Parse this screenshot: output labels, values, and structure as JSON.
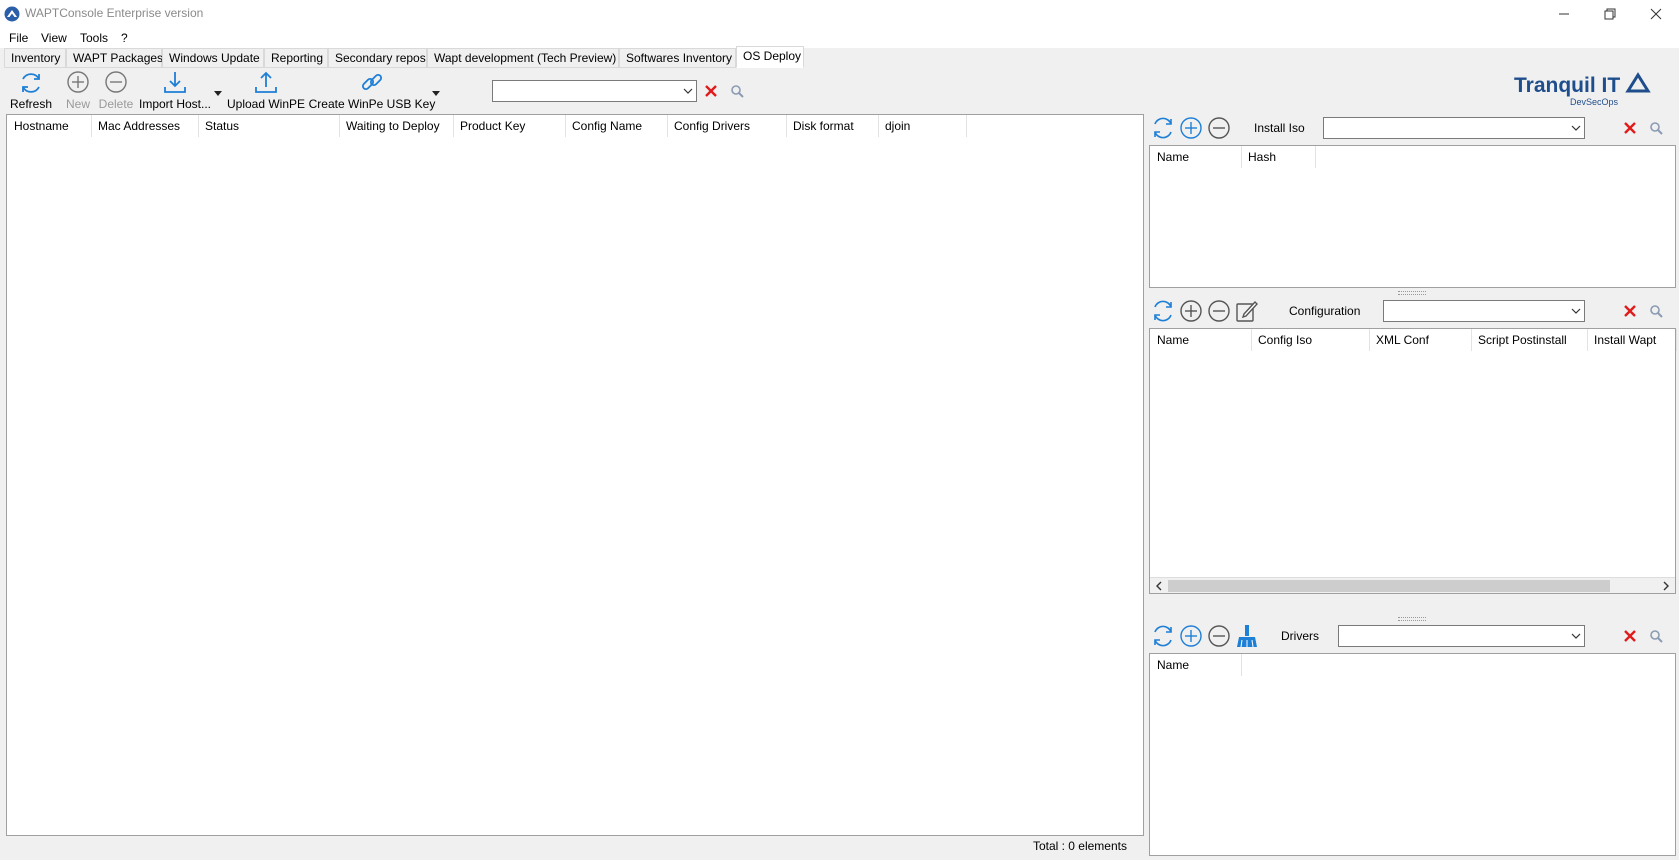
{
  "window": {
    "title": "WAPTConsole Enterprise version"
  },
  "menu": [
    "File",
    "View",
    "Tools",
    "?"
  ],
  "tabs": [
    {
      "label": "Inventory",
      "active": false
    },
    {
      "label": "WAPT Packages",
      "active": false
    },
    {
      "label": "Windows Update",
      "active": false
    },
    {
      "label": "Reporting",
      "active": false
    },
    {
      "label": "Secondary repos",
      "active": false
    },
    {
      "label": "Wapt development (Tech Preview)",
      "active": false
    },
    {
      "label": "Softwares Inventory",
      "active": false
    },
    {
      "label": "OS Deploy",
      "active": true
    }
  ],
  "toolbar": {
    "refresh": "Refresh",
    "new": "New",
    "delete": "Delete",
    "import_host": "Import Host...",
    "upload_winpe": "Upload WinPE",
    "create_usb": "Create WinPe USB Key",
    "search_value": ""
  },
  "hosts_table": {
    "columns": [
      "Hostname",
      "Mac Addresses",
      "Status",
      "Waiting to Deploy",
      "Product Key",
      "Config Name",
      "Config Drivers",
      "Disk format",
      "djoin"
    ],
    "rows": []
  },
  "status": {
    "total": "Total : 0 elements"
  },
  "logo": {
    "name": "Tranquil IT",
    "tagline": "DevSecOps"
  },
  "install_iso": {
    "label": "Install Iso",
    "search_value": "",
    "columns": [
      "Name",
      "Hash"
    ]
  },
  "configuration": {
    "label": "Configuration",
    "search_value": "",
    "columns": [
      "Name",
      "Config Iso",
      "XML Conf",
      "Script Postinstall",
      "Install Wapt"
    ]
  },
  "drivers": {
    "label": "Drivers",
    "search_value": "",
    "columns": [
      "Name"
    ]
  },
  "colors": {
    "accent_blue": "#1e7fd6",
    "delete_red": "#e01b1b",
    "logo_blue": "#1f4e8c"
  }
}
